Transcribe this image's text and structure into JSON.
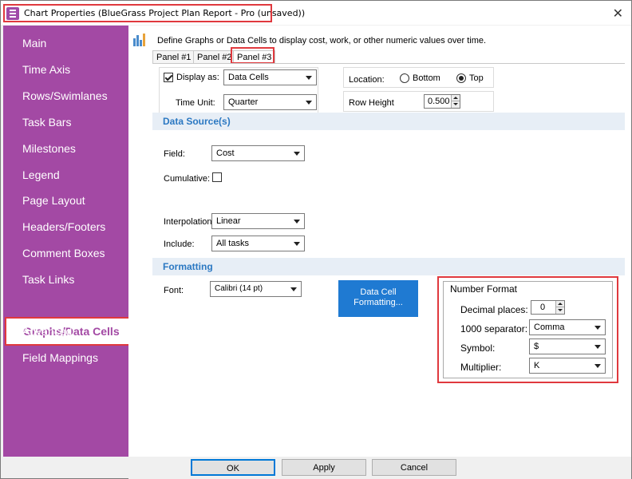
{
  "window": {
    "title": "Chart Properties (BlueGrass Project Plan Report - Pro (unsaved))",
    "close_glyph": "✕"
  },
  "sidebar": {
    "items": [
      {
        "label": "Main"
      },
      {
        "label": "Time Axis"
      },
      {
        "label": "Rows/Swimlanes"
      },
      {
        "label": "Task Bars"
      },
      {
        "label": "Milestones"
      },
      {
        "label": "Legend"
      },
      {
        "label": "Page Layout"
      },
      {
        "label": "Headers/Footers"
      },
      {
        "label": "Comment Boxes"
      },
      {
        "label": "Task Links"
      },
      {
        "label": "Graphs/Data Cells"
      },
      {
        "label": "Advanced"
      },
      {
        "label": "Field Mappings"
      }
    ],
    "active": "Graphs/Data Cells",
    "bg_color": "#a349a4"
  },
  "header": {
    "description": "Define Graphs or Data Cells to display cost, work, or other numeric values over time."
  },
  "tabs": [
    {
      "label": "Panel #1"
    },
    {
      "label": "Panel #2"
    },
    {
      "label": "Panel #3"
    }
  ],
  "display": {
    "display_as_label": "Display as:",
    "display_as_checked": true,
    "display_as_value": "Data Cells",
    "time_unit_label": "Time Unit:",
    "time_unit_value": "Quarter",
    "location_label": "Location:",
    "location_bottom": "Bottom",
    "location_top": "Top",
    "location_selected": "Top",
    "row_height_label": "Row Height",
    "row_height_value": "0.500"
  },
  "data_source": {
    "heading": "Data Source(s)",
    "field_label": "Field:",
    "field_value": "Cost",
    "cumulative_label": "Cumulative:",
    "cumulative_checked": false,
    "interpolation_label": "Interpolation:",
    "interpolation_value": "Linear",
    "include_label": "Include:",
    "include_value": "All tasks"
  },
  "formatting": {
    "heading": "Formatting",
    "font_label": "Font:",
    "font_value": "Calibri (14 pt)",
    "data_cell_button_line1": "Data Cell",
    "data_cell_button_line2": "Formatting...",
    "number_format": {
      "title": "Number Format",
      "decimal_label": "Decimal places:",
      "decimal_value": "0",
      "separator_label": "1000 separator:",
      "separator_value": "Comma",
      "symbol_label": "Symbol:",
      "symbol_value": "$",
      "multiplier_label": "Multiplier:",
      "multiplier_value": "K"
    }
  },
  "buttons": {
    "ok": "OK",
    "apply": "Apply",
    "cancel": "Cancel"
  },
  "colors": {
    "accent": "#2b78c2",
    "highlight": "#e0393e",
    "button_blue": "#1f7ad2"
  }
}
